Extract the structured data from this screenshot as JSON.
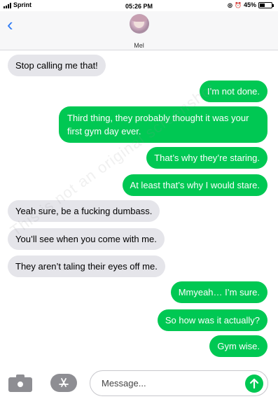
{
  "status_bar": {
    "carrier": "Sprint",
    "time": "05:26 PM",
    "battery_text": "45%",
    "battery_level": 0.45,
    "icons": [
      "signal-bars-icon",
      "location-icon",
      "alarm-icon",
      "battery-icon"
    ]
  },
  "header": {
    "back_icon": "chevron-left-icon",
    "contact_name": "Mel"
  },
  "messages": [
    {
      "direction": "incoming",
      "text": "Stop calling me that!"
    },
    {
      "direction": "outgoing",
      "text": "I’m not done."
    },
    {
      "direction": "outgoing",
      "text": "Third thing, they probably thought it was your first gym day ever."
    },
    {
      "direction": "outgoing",
      "text": "That’s why they’re staring."
    },
    {
      "direction": "outgoing",
      "text": "At least that’s why I would stare."
    },
    {
      "direction": "incoming",
      "text": "Yeah sure, be a fucking dumbass."
    },
    {
      "direction": "incoming",
      "text": "You’ll see when you come with me."
    },
    {
      "direction": "incoming",
      "text": "They aren’t taling their eyes off me."
    },
    {
      "direction": "outgoing",
      "text": "Mmyeah… I’m sure."
    },
    {
      "direction": "outgoing",
      "text": "So how was it actually?"
    },
    {
      "direction": "outgoing",
      "text": "Gym wise."
    }
  ],
  "watermark": "This is not an original screenshot",
  "input_bar": {
    "placeholder": "Message...",
    "camera_icon": "camera-icon",
    "apps_icon": "app-store-icon",
    "send_icon": "send-arrow-icon"
  },
  "colors": {
    "outgoing_bubble": "#00c853",
    "incoming_bubble": "#e5e5ea",
    "accent": "#2f7cf6"
  }
}
